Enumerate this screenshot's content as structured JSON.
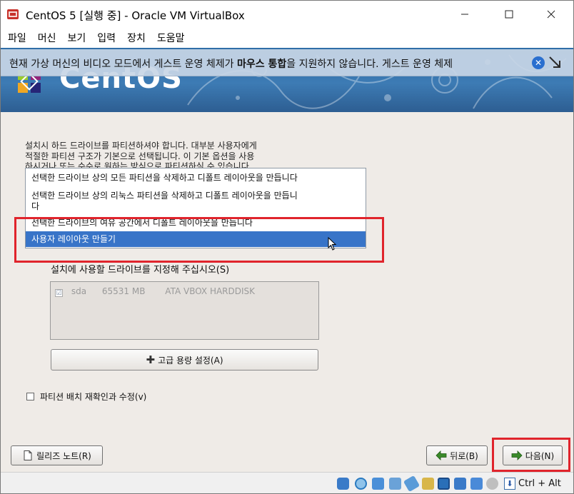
{
  "window": {
    "title": "CentOS 5 [실행 중] - Oracle VM VirtualBox",
    "minimize": "—",
    "maximize": "☐",
    "close": "✕"
  },
  "menu": [
    "파일",
    "머신",
    "보기",
    "입력",
    "장치",
    "도움말"
  ],
  "notification": {
    "text_before": "현재 가상 머신의 비디오 모드에서 게스트 운영 체제가 ",
    "text_bold": "마우스 통합",
    "text_after": "을 지원하지 않습니다. 게스트 운영 체제",
    "close_icon": "close-circle-icon"
  },
  "banner": {
    "logo_text": "CentOS"
  },
  "installer": {
    "intro_lines": [
      "설치시 하드 드라이브를 파티션하셔야 합니다. 대부분 사용자에게",
      "적절한 파티션 구조가 기본으로 선택됩니다. 이 기본 옵션을 사용",
      "하시거나 또는 수수로 원하는 방식으로 파티션하실 수 있습니다"
    ],
    "layout_options": [
      "선택한 드라이브 상의 모든 파티션을 삭제하고 디폴트 레이아웃을 만듭니다",
      "선택한 드라이브 상의 리눅스 파티션을 삭제하고 디폴트 레이아웃을 만듭니",
      "다",
      "선택한 드라이브의 여유 공간에서 디폴트 레이아웃을 만듭니다",
      "사용자 레이아웃 만들기"
    ],
    "selected_option_index": 3,
    "drive_label": "설치에 사용할 드라이브를 지정해 주십시오(S)",
    "drive": {
      "checked": true,
      "check_mark": "☑",
      "name": "sda",
      "size": "65531 MB",
      "model": "ATA VBOX HARDDISK"
    },
    "advanced_button": "고급 용량 설정(A)",
    "review_checkbox": "파티션 배치 재확인과 수정(v)",
    "release_notes_button": "릴리즈 노트(R)",
    "back_button": "뒤로(B)",
    "next_button": "다음(N)"
  },
  "statusbar": {
    "host_key": "Ctrl + Alt",
    "icons": [
      "hard-disk-icon",
      "optical-drive-icon",
      "audio-icon",
      "network-icon",
      "usb-icon",
      "shared-folder-icon",
      "display-icon",
      "video-capture-icon",
      "mouse-integration-icon",
      "cpu-icon",
      "host-key-icon"
    ]
  },
  "colors": {
    "accent": "#3874c8",
    "highlight_box": "#e0242c",
    "banner": "#3d7bb4"
  }
}
